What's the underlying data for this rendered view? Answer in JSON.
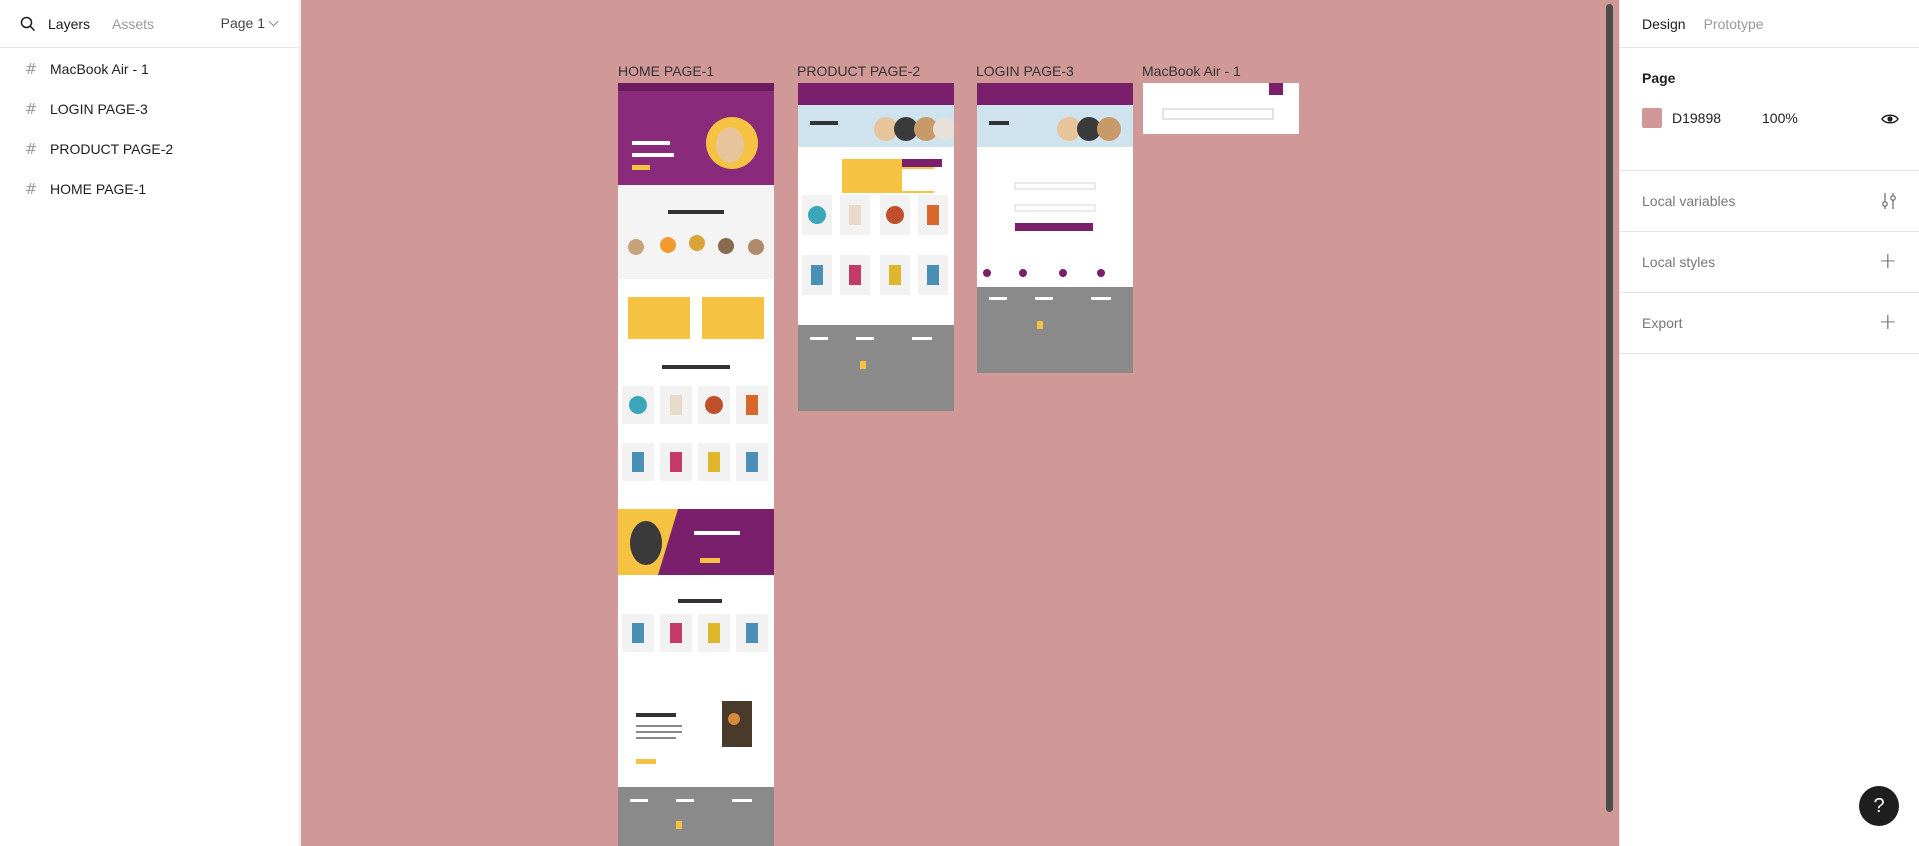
{
  "left_panel": {
    "tabs": {
      "layers": "Layers",
      "assets": "Assets"
    },
    "page_selector": "Page 1",
    "layers": [
      {
        "label": "MacBook Air - 1"
      },
      {
        "label": "LOGIN PAGE-3"
      },
      {
        "label": "PRODUCT PAGE-2"
      },
      {
        "label": "HOME PAGE-1"
      }
    ]
  },
  "canvas": {
    "background": "#D19898",
    "frames": [
      {
        "label": "HOME PAGE-1"
      },
      {
        "label": "PRODUCT PAGE-2"
      },
      {
        "label": "LOGIN PAGE-3"
      },
      {
        "label": "MacBook Air - 1"
      }
    ],
    "home_frame": {
      "hero_text": "A GREAT MEAL WITH YOUR PET",
      "category_title": "SHOP BY CATEGORY",
      "new_collection_title": "NEW COLLECTION",
      "deal_title": "Best Deal Offer",
      "deals_of_day_title": "DEALS OF THE DAY",
      "best_food_title": "Best Pet Food",
      "footer_cols": [
        "About Us",
        "Contact Us",
        "Information"
      ]
    },
    "product_frame": {
      "hero_title": "Products",
      "footer_cols": [
        "About Us",
        "Contact Us",
        "Information"
      ]
    },
    "login_frame": {
      "hero_title": "Login",
      "button": "LOGIN",
      "footer_cols": [
        "About Us",
        "Contact Us",
        "Information"
      ]
    },
    "macbook_frame": {
      "close": "X"
    },
    "colors": {
      "purple": "#7a1f6b",
      "yellow": "#f5c242",
      "footer_gray": "#8a8a8a",
      "hero_blue": "#cfe3ef"
    }
  },
  "right_panel": {
    "tabs": {
      "design": "Design",
      "prototype": "Prototype"
    },
    "page": {
      "title": "Page",
      "color_hex": "D19898",
      "opacity": "100%",
      "swatch": "#D19898"
    },
    "sections": [
      {
        "label": "Local variables",
        "icon": "sliders-icon"
      },
      {
        "label": "Local styles",
        "icon": "plus-icon"
      },
      {
        "label": "Export",
        "icon": "plus-icon"
      }
    ],
    "help": "?"
  }
}
